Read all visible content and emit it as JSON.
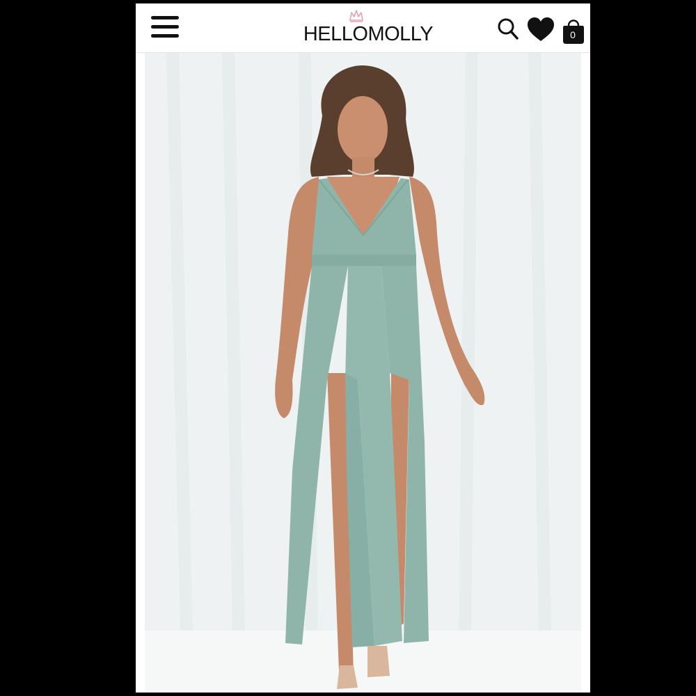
{
  "header": {
    "menu_icon": "hamburger-menu-icon",
    "logo_text": "HELLOMOLLY",
    "logo_crown_color": "#e8a0b4",
    "search_icon": "search-icon",
    "wishlist_icon": "heart-icon",
    "bag_icon": "shopping-bag-icon",
    "bag_count": "0"
  },
  "product": {
    "image_description_icon": "product-photo",
    "garment_color": "#8fb5ab",
    "backdrop_color": "#f1f4f4"
  }
}
